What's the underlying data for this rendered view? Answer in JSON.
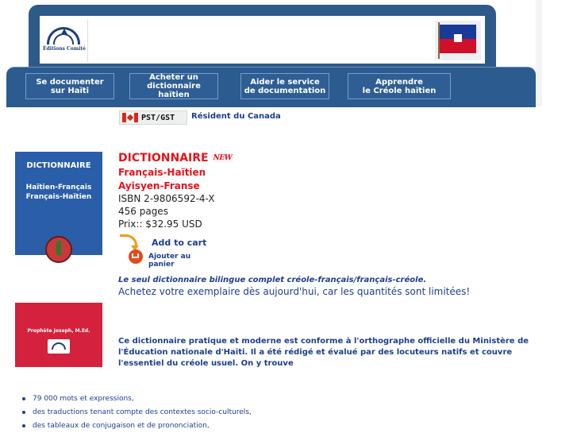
{
  "header": {
    "logo_text": "Éditions Comité",
    "nav": [
      {
        "label": "Se documenter\nsur Haïti"
      },
      {
        "label": "Acheter un\ndictionnaire haïtien"
      },
      {
        "label": "Aider le service\nde documentation"
      },
      {
        "label": "Apprendre\nle Créole haïtien"
      }
    ]
  },
  "resident": {
    "badge": "PST/GST",
    "text": "Résident du Canada"
  },
  "book": {
    "cover_title": "DICTIONNAIRE",
    "cover_sub1": "Haïtien-Français",
    "cover_sub2": "Français-Haïtien",
    "author": "Prophète Joseph, M.Ed."
  },
  "product": {
    "title": "DICTIONNAIRE",
    "new_badge": "NEW",
    "line1": "Français-Haïtien",
    "line2": "Ayisyen-Franse",
    "isbn": "ISBN 2-9806592-4-X",
    "pages": "456 pages",
    "price": "Prix:: $32.95 USD",
    "add_to_cart": "Add to cart",
    "ajouter": "Ajouter au panier"
  },
  "tagline": "Le seul dictionnaire bilingue complet créole-français/français-créole.",
  "cta": "Achetez votre exemplaire dès aujourd'hui, car les quantités sont limitées!",
  "description": "Ce dictionnaire pratique et moderne est conforme à l'orthographe officielle du Ministère de l'Éducation nationale d'Haïti. Il a été rédigé et évalué par des locuteurs natifs et couvre l'essentiel du créole usuel. On y trouve",
  "features": [
    "79 000 mots et expressions,",
    "des traductions tenant compte des contextes socio-culturels,",
    "des tableaux de conjugaison et de prononciation,"
  ],
  "colors": {
    "nav_blue": "#2b5b8f",
    "title_red": "#e4141c",
    "text_blue": "#1d3e8f"
  }
}
